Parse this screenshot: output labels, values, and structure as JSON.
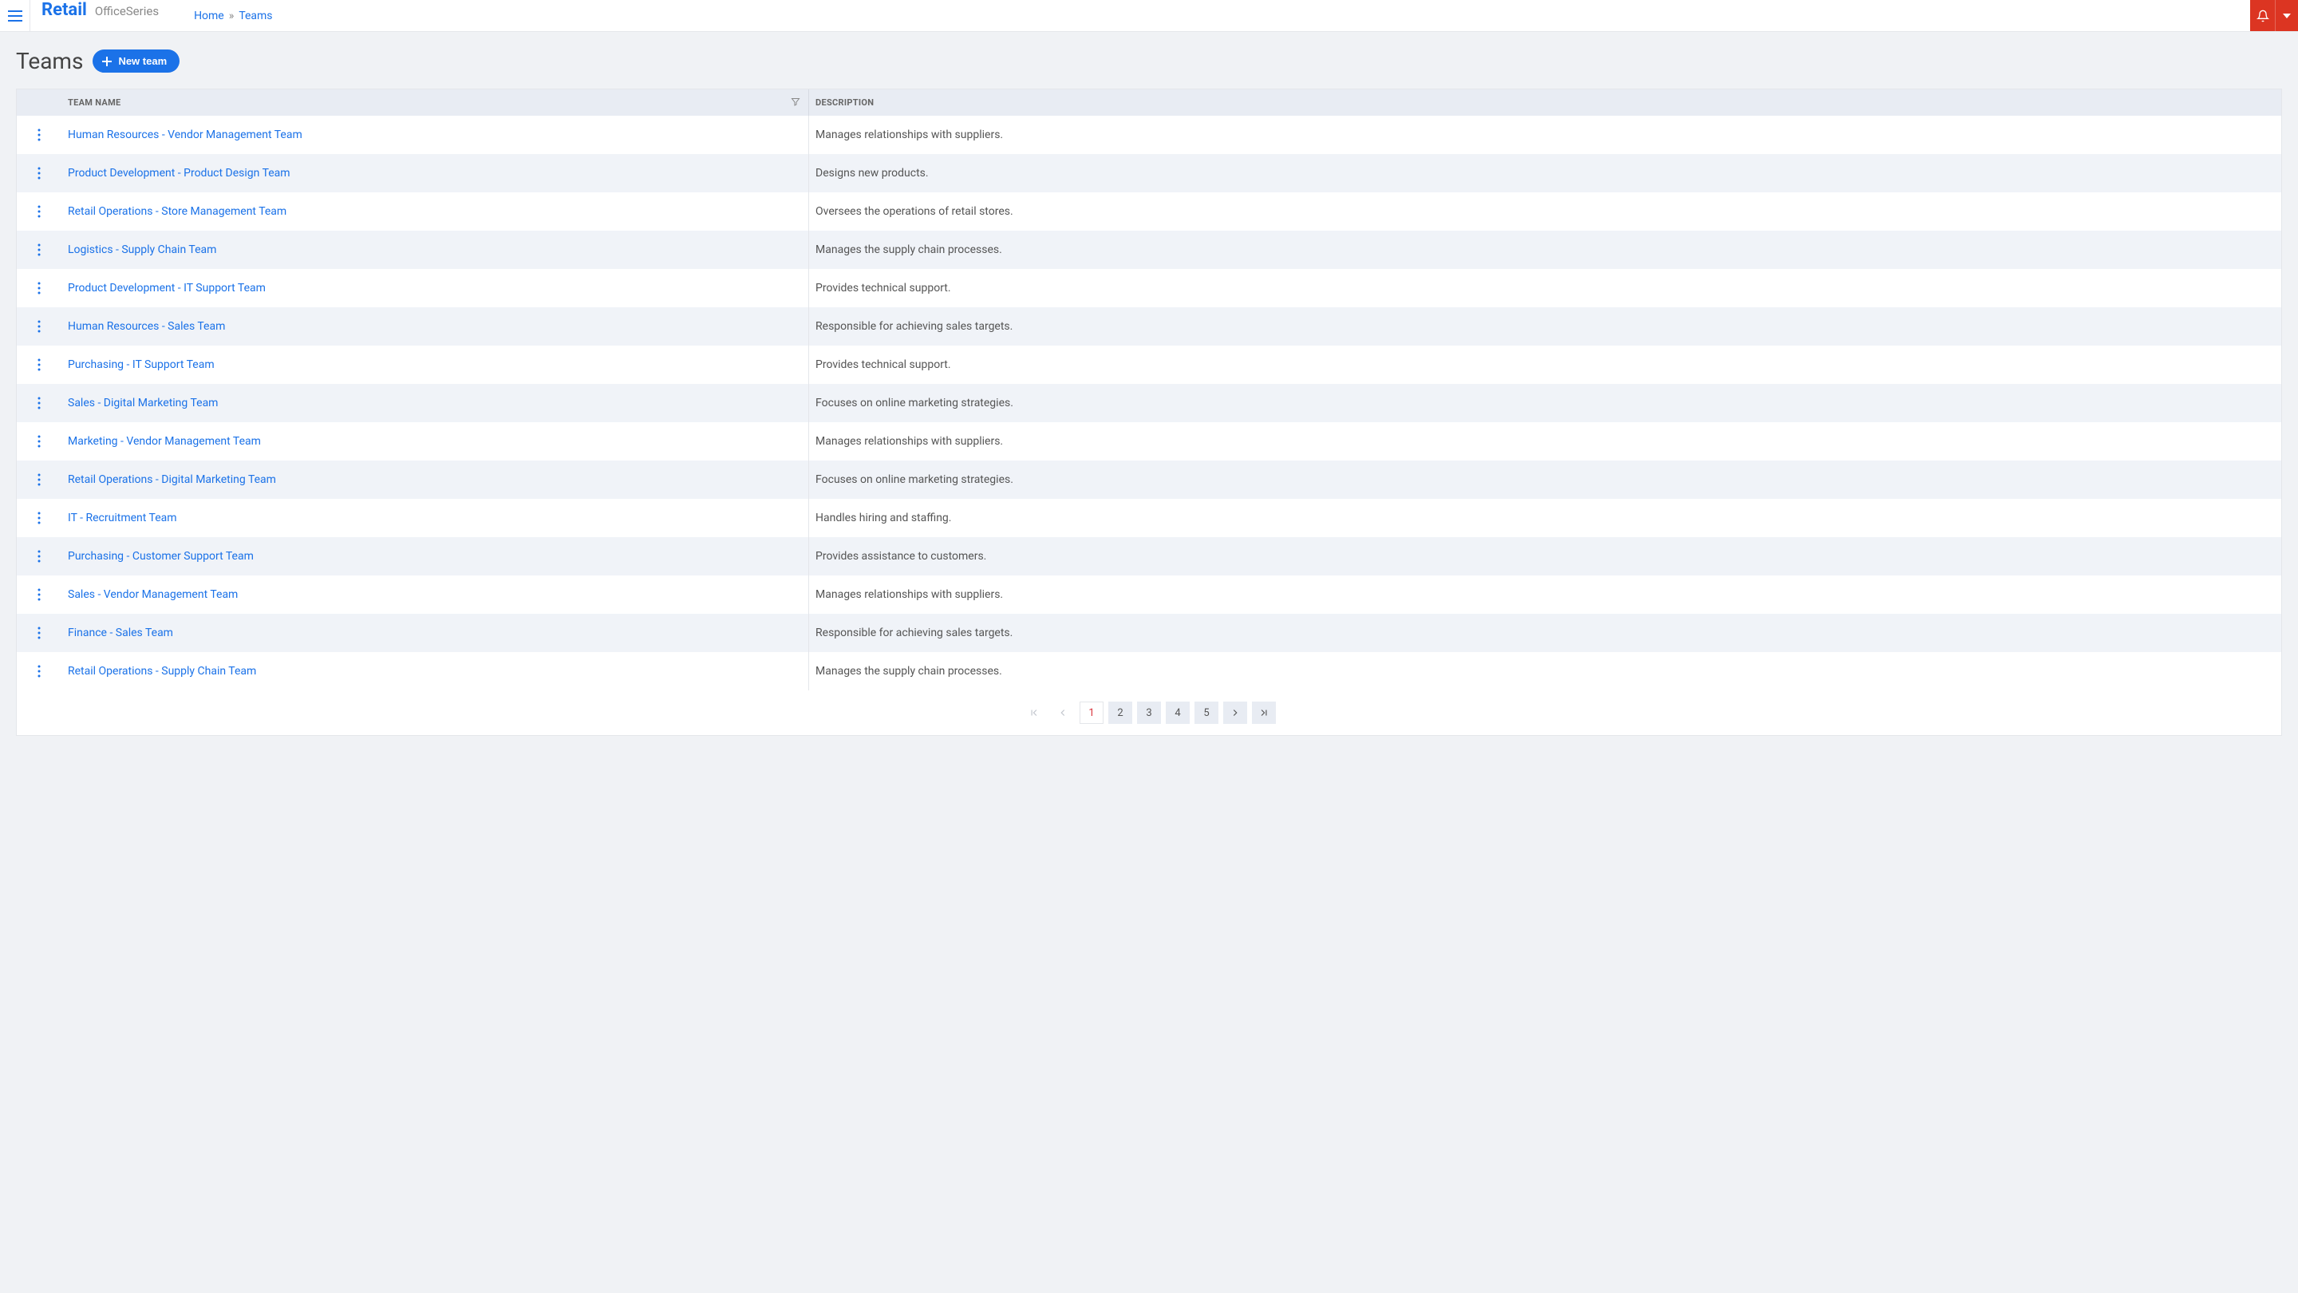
{
  "header": {
    "brand_main": "Retail",
    "brand_sub": "OfficeSeries",
    "breadcrumbs": {
      "home": "Home",
      "sep": "»",
      "current": "Teams"
    }
  },
  "page": {
    "title": "Teams",
    "new_team_label": "New team"
  },
  "table": {
    "columns": {
      "name": "Team Name",
      "description": "Description"
    },
    "rows": [
      {
        "name": "Human Resources - Vendor Management Team",
        "description": "Manages relationships with suppliers."
      },
      {
        "name": "Product Development - Product Design Team",
        "description": "Designs new products."
      },
      {
        "name": "Retail Operations - Store Management Team",
        "description": "Oversees the operations of retail stores."
      },
      {
        "name": "Logistics - Supply Chain Team",
        "description": "Manages the supply chain processes."
      },
      {
        "name": "Product Development - IT Support Team",
        "description": "Provides technical support."
      },
      {
        "name": "Human Resources - Sales Team",
        "description": "Responsible for achieving sales targets."
      },
      {
        "name": "Purchasing - IT Support Team",
        "description": "Provides technical support."
      },
      {
        "name": "Sales - Digital Marketing Team",
        "description": "Focuses on online marketing strategies."
      },
      {
        "name": "Marketing - Vendor Management Team",
        "description": "Manages relationships with suppliers."
      },
      {
        "name": "Retail Operations - Digital Marketing Team",
        "description": "Focuses on online marketing strategies."
      },
      {
        "name": "IT - Recruitment Team",
        "description": "Handles hiring and staffing."
      },
      {
        "name": "Purchasing - Customer Support Team",
        "description": "Provides assistance to customers."
      },
      {
        "name": "Sales - Vendor Management Team",
        "description": "Manages relationships with suppliers."
      },
      {
        "name": "Finance - Sales Team",
        "description": "Responsible for achieving sales targets."
      },
      {
        "name": "Retail Operations - Supply Chain Team",
        "description": "Manages the supply chain processes."
      }
    ]
  },
  "pagination": {
    "pages": [
      "1",
      "2",
      "3",
      "4",
      "5"
    ],
    "current": "1"
  }
}
